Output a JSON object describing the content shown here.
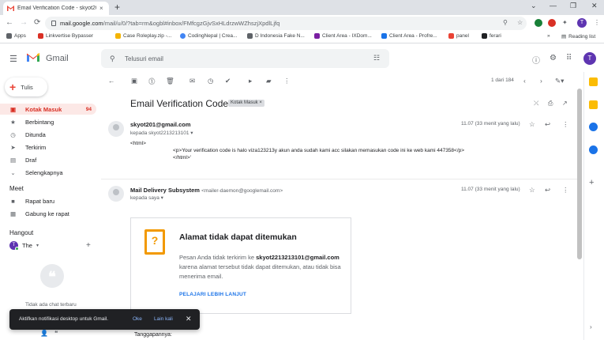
{
  "browser": {
    "tab_title": "Email Verification Code - skyot20...",
    "tab_close": "×",
    "new_tab": "+",
    "window_controls": [
      "⌄",
      "—",
      "❐",
      "✕"
    ],
    "nav": {
      "back": "←",
      "forward": "→",
      "reload": "⟳"
    },
    "url_host": "mail.google.com",
    "url_path": "/mail/u/0/?tab=rm&ogbl#inbox/FMfcgzGjvSxHLdrzwWZhszjXpdlLjfq",
    "profile_initial": "T",
    "bookmarks": [
      {
        "label": "Apps",
        "color": "#5f6368"
      },
      {
        "label": "Linkvertise Bypasser",
        "color": "#d93025"
      },
      {
        "label": "Case Roleplay.zip -...",
        "color": "#f4b400"
      },
      {
        "label": "CodingNepal | Crea...",
        "color": "#4285f4"
      },
      {
        "label": "D Indonesia Fake N...",
        "color": "#5f6368"
      },
      {
        "label": "Client Area - IXDom...",
        "color": "#7b1fa2"
      },
      {
        "label": "Client Area - Profre...",
        "color": "#1a73e8"
      },
      {
        "label": "panel",
        "color": "#ea4335"
      },
      {
        "label": "ferari",
        "color": "#202124"
      }
    ],
    "bookmarks_more": "»",
    "reading_list": "Reading list"
  },
  "gmail": {
    "logo_text": "Gmail",
    "search_placeholder": "Telusuri email",
    "avatar_initial": "T",
    "compose_label": "Tulis",
    "sidebar": [
      {
        "label": "Kotak Masuk",
        "count": "94",
        "icon": "inbox-icon",
        "glyph": "▣",
        "active": true
      },
      {
        "label": "Berbintang",
        "count": "",
        "icon": "star-icon",
        "glyph": "★",
        "active": false
      },
      {
        "label": "Ditunda",
        "count": "",
        "icon": "clock-icon",
        "glyph": "◷",
        "active": false
      },
      {
        "label": "Terkirim",
        "count": "",
        "icon": "send-icon",
        "glyph": "➤",
        "active": false
      },
      {
        "label": "Draf",
        "count": "",
        "icon": "draft-icon",
        "glyph": "▤",
        "active": false
      },
      {
        "label": "Selengkapnya",
        "count": "",
        "icon": "chevron-down-icon",
        "glyph": "⌄",
        "active": false
      }
    ],
    "meet_header": "Meet",
    "meet_items": [
      {
        "label": "Rapat baru",
        "icon": "video-icon",
        "glyph": "■"
      },
      {
        "label": "Gabung ke rapat",
        "icon": "keyboard-icon",
        "glyph": "▦"
      }
    ],
    "hangout_header": "Hangout",
    "hangout_user": "The",
    "hangout_user_initial": "T",
    "hangout_user_suffix": "▾",
    "hangout_add": "+",
    "no_chat": "Tidak ada chat terbaru",
    "pager": "1 dari 184",
    "subject": "Email Verification Code",
    "label_chip": "Kotak Masuk ×",
    "messages": [
      {
        "sender": "skyot201@gmail.com",
        "sender_email": "",
        "to": "kepada skyot2213213101 ▾",
        "time": "11.07 (33 menit yang lalu)",
        "body": [
          "<html>",
          "<p>Your verification code is halo viza123213y akun anda sudah kami acc silakan memasukan code ini ke web kami 447358</p>",
          "</html>'"
        ]
      },
      {
        "sender": "Mail Delivery Subsystem",
        "sender_email": "<mailer-daemon@googlemail.com>",
        "to": "kepada saya ▾",
        "time": "11.07 (33 menit yang lalu)"
      }
    ],
    "bounce": {
      "title": "Alamat tidak dapat ditemukan",
      "line1_pre": "Pesan Anda tidak terkirim ke ",
      "line1_addr": "skyot2213213101@gmail.com",
      "line2": "karena alamat tersebut tidak dapat ditemukan, atau tidak bisa",
      "line3": "menerima email.",
      "link": "PELAJARI LEBIH LANJUT"
    },
    "reply_hint": "Tanggapannya:",
    "snackbar": {
      "text": "Aktifkan notifikasi desktop untuk Gmail.",
      "ok": "Oke",
      "later": "Lain kali",
      "close": "✕"
    }
  }
}
